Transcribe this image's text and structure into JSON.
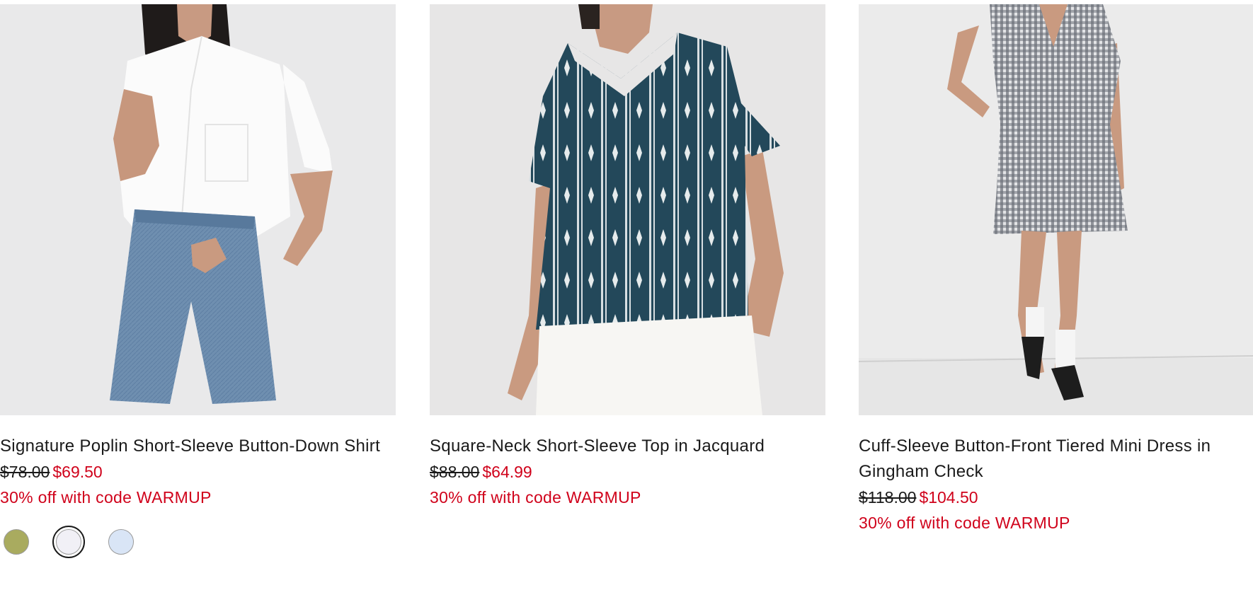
{
  "products": [
    {
      "name": "Signature Poplin Short-Sleeve Button-Down Shirt",
      "original_price": "$78.00",
      "sale_price": "$69.50",
      "promo": "30% off with code WARMUP",
      "swatches": [
        {
          "color": "#a9ab5f"
        },
        {
          "color": "#f1f0f6"
        },
        {
          "color": "#d9e5f6"
        }
      ]
    },
    {
      "name": "Square-Neck Short-Sleeve Top in Jacquard",
      "original_price": "$88.00",
      "sale_price": "$64.99",
      "promo": "30% off with code WARMUP"
    },
    {
      "name": "Cuff-Sleeve Button-Front Tiered Mini Dress in Gingham Check",
      "original_price": "$118.00",
      "sale_price": "$104.50",
      "promo": "30% off with code WARMUP"
    }
  ],
  "colors": {
    "sale": "#d0021b",
    "text": "#1a1a1a"
  }
}
